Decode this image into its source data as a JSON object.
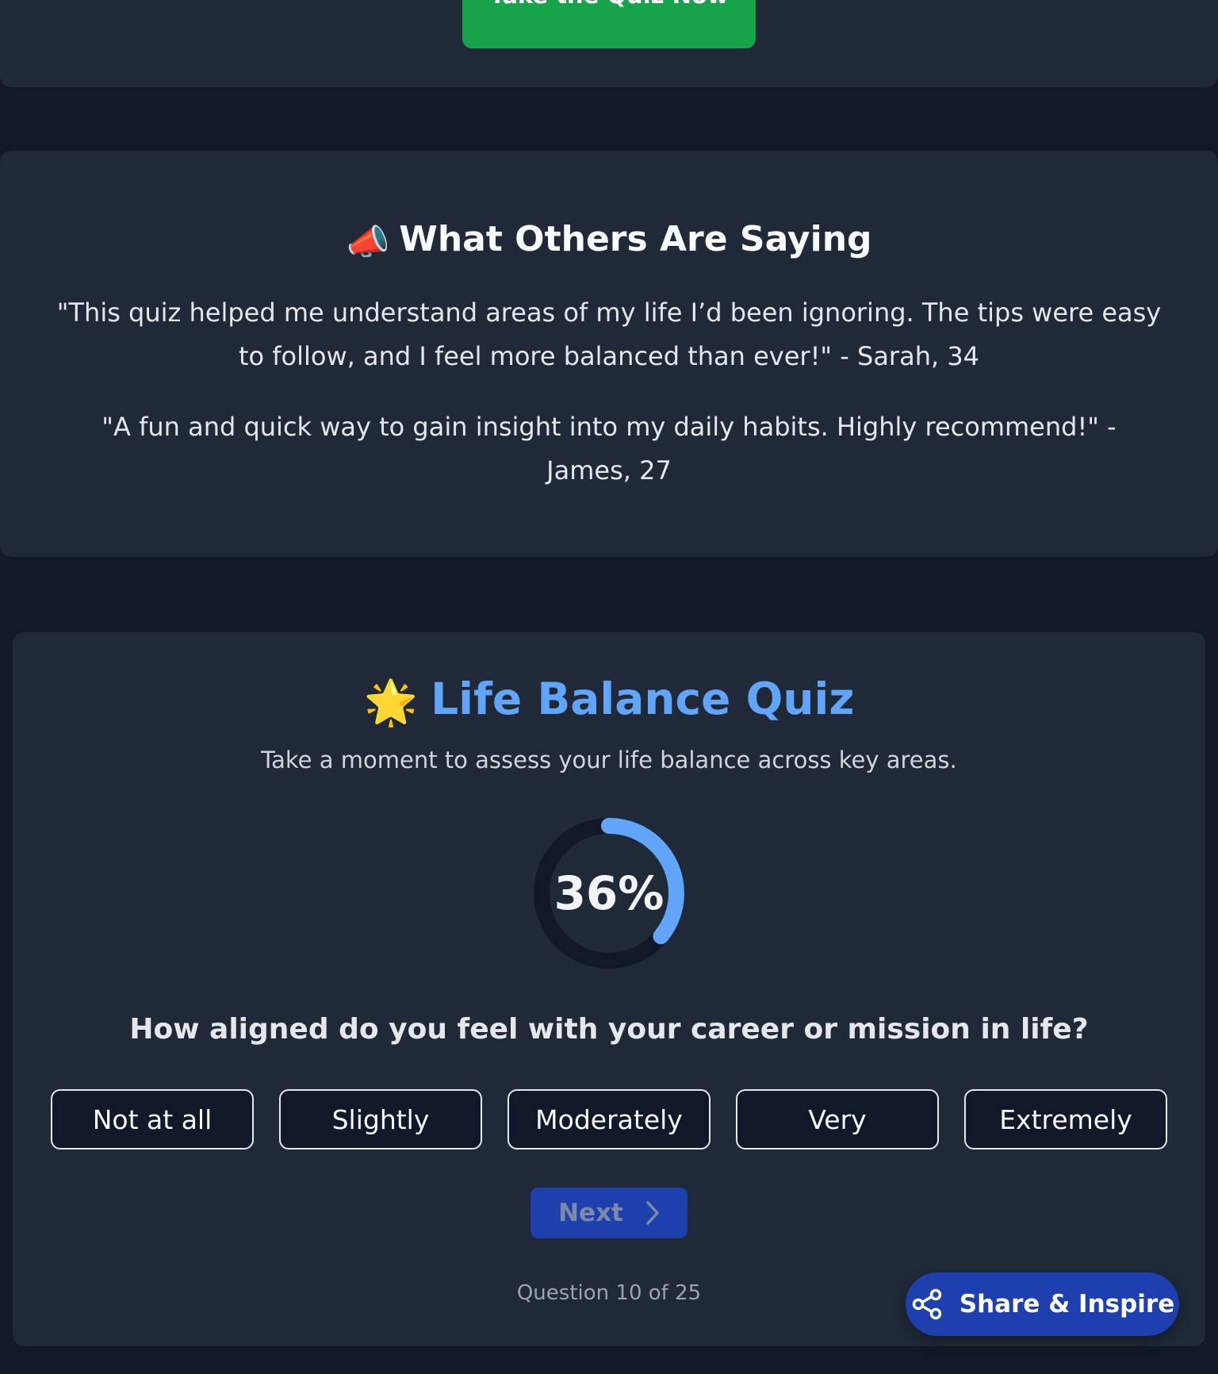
{
  "cta": {
    "button_label": "Take the Quiz Now"
  },
  "testimonials": {
    "heading_emoji": "📣",
    "heading": "What Others Are Saying",
    "items": [
      "\"This quiz helped me understand areas of my life I’d been ignoring. The tips were easy to follow, and I feel more balanced than ever!\" - Sarah, 34",
      "\"A fun and quick way to gain insight into my daily habits. Highly recommend!\" - James, 27"
    ]
  },
  "quiz": {
    "title_emoji": "🌟",
    "title": "Life Balance Quiz",
    "subtitle": "Take a moment to assess your life balance across key areas.",
    "progress_percent": 36,
    "progress_label": "36%",
    "question": "How aligned do you feel with your career or mission in life?",
    "options": [
      "Not at all",
      "Slightly",
      "Moderately",
      "Very",
      "Extremely"
    ],
    "next_label": "Next",
    "counter": "Question 10 of 25"
  },
  "share": {
    "label": "Share & Inspire",
    "icon": "share-icon"
  },
  "colors": {
    "page_bg": "#111827",
    "card_bg": "#1f2937",
    "accent_blue": "#60a5fa",
    "cta_green": "#16a34a",
    "button_blue": "#1e40af"
  }
}
